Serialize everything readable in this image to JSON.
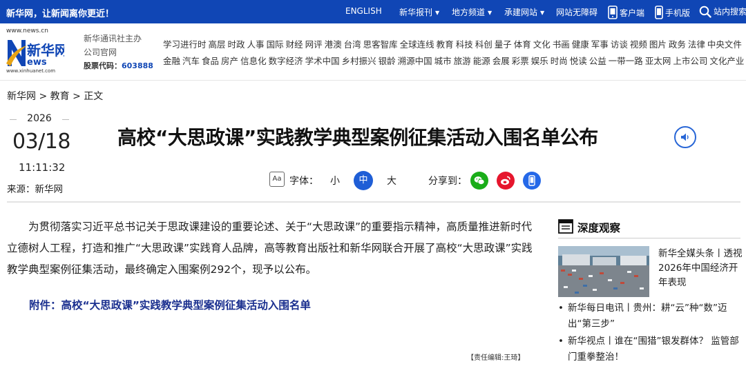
{
  "topbar": {
    "slogan": "新华网，让新闻离你更近！",
    "nav": [
      "ENGLISH",
      "新华报刊",
      "地方频道",
      "承建网站"
    ],
    "barrier_free": "网站无障碍",
    "client": "客户端",
    "mobile": "手机版",
    "search": "站内搜索",
    "bg_color": "#1046b5"
  },
  "header": {
    "logo_url_top": "www.news.cn",
    "logo_text": "新华网",
    "logo_url_bottom": "www.xinhuanet.com",
    "org_line1": "新华通讯社主办",
    "org_line2": "公司官网",
    "stock_label": "股票代码：",
    "stock_code": "603888",
    "channels_row1": [
      "学习进行时",
      "高层",
      "时政",
      "人事",
      "国际",
      "财经",
      "网评",
      "港澳",
      "台湾",
      "思客智库",
      "全球连线",
      "教育",
      "科技",
      "科创",
      "量子",
      "体育",
      "文化",
      "书画",
      "健康",
      "军事",
      "访谈",
      "视频",
      "图片",
      "政务",
      "法律",
      "中央文件"
    ],
    "channels_row2": [
      "金融",
      "汽车",
      "食品",
      "房产",
      "信息化",
      "数字经济",
      "学术中国",
      "乡村振兴",
      "银龄",
      "溯源中国",
      "城市",
      "旅游",
      "能源",
      "会展",
      "彩票",
      "娱乐",
      "时尚",
      "悦读",
      "公益",
      "一带一路",
      "亚太网",
      "上市公司",
      "文化产业"
    ]
  },
  "breadcrumb": "新华网 > 教育 > 正文",
  "article": {
    "year": "2026",
    "month_day": "03/18",
    "time": "11:11:32",
    "source": "来源：新华网",
    "title": "高校“大思政课”实践教学典型案例征集活动入围名单公布",
    "font_label": "字体：",
    "font_small": "小",
    "font_medium": "中",
    "font_large": "大",
    "share_label": "分享到：",
    "body": "为贯彻落实习近平总书记关于思政课建设的重要论述、关于“大思政课”的重要指示精神，高质量推进新时代立德树人工程，打造和推广“大思政课”实践育人品牌，高等教育出版社和新华网联合开展了高校“大思政课”实践教学典型案例征集活动，最终确定入围案例292个，现予以公布。",
    "attachment": "附件：高校“大思政课”实践教学典型案例征集活动入围名单",
    "editor": "【责任编辑:王琦】"
  },
  "sidebar": {
    "heading": "深度观察",
    "feature_caption": "新华全媒头条丨透视2026年中国经济开年表现",
    "items": [
      "新华每日电讯丨贵州：耕“云”种“数”迈出“第三步”",
      "新华视点丨谁在“围猎”银发群体？ 监管部门重拳整治！"
    ]
  },
  "colors": {
    "accent": "#1f5ed6",
    "link_dark_blue": "#1a2f8f",
    "wechat": "#1aad19",
    "weibo": "#e6162d",
    "mobile": "#2568e8"
  }
}
